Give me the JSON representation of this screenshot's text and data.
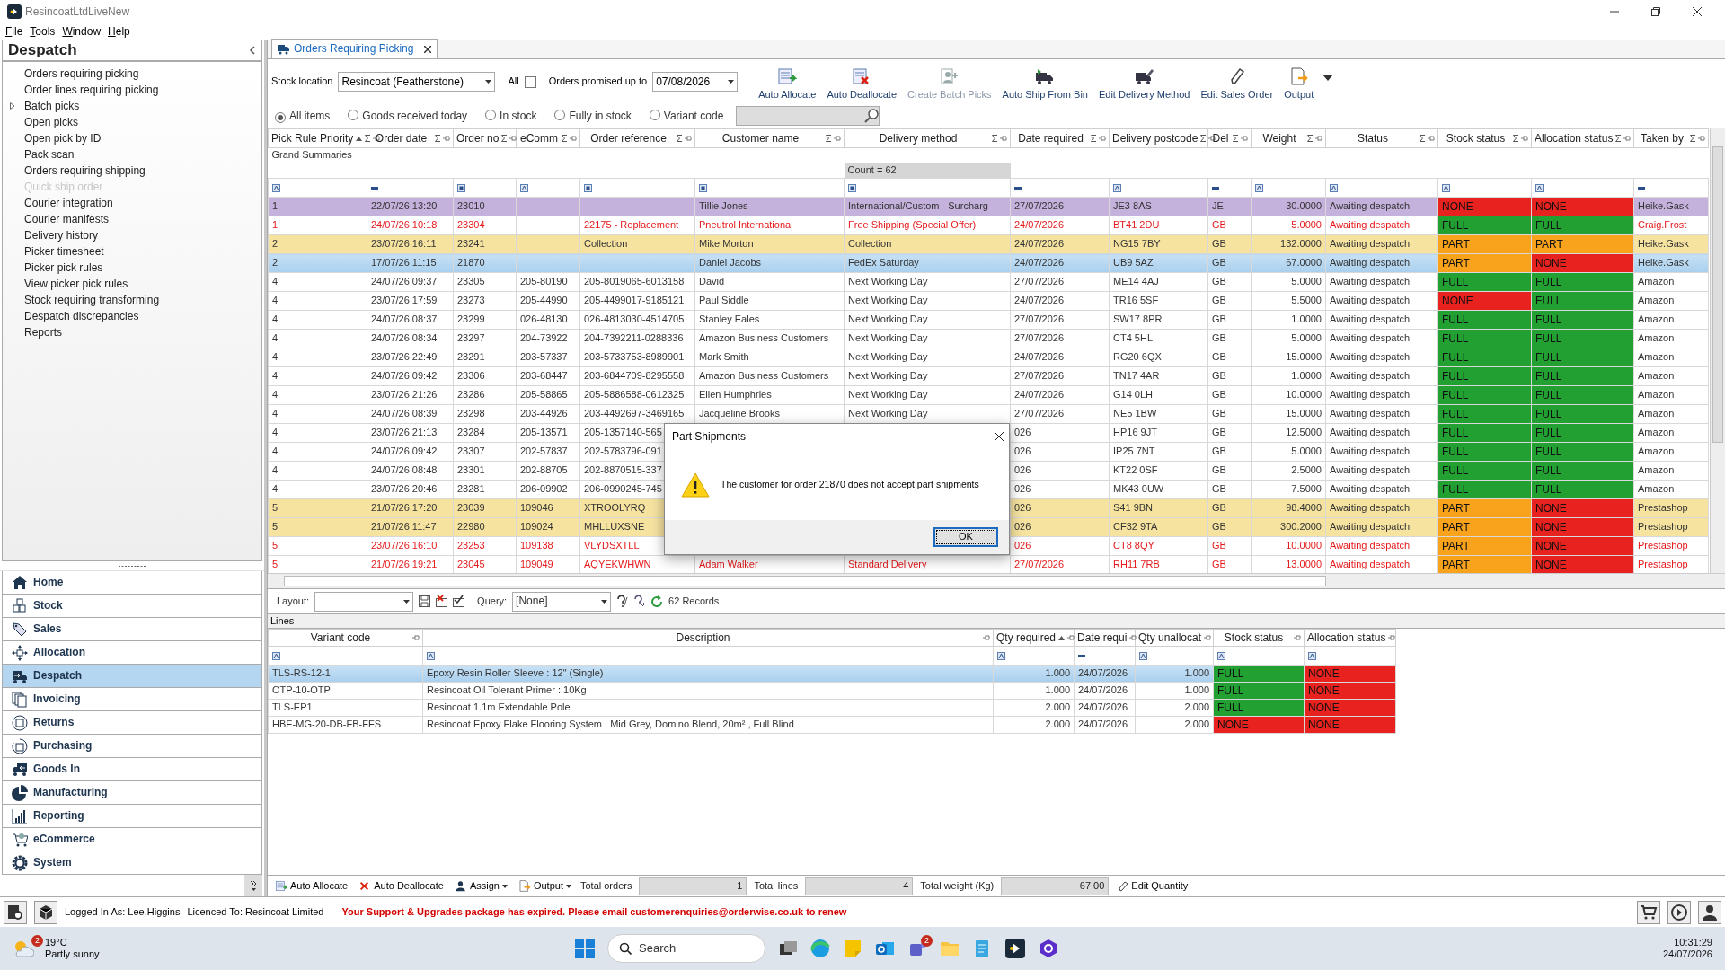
{
  "window": {
    "title": "ResincoatLtdLiveNew"
  },
  "menu": [
    "File",
    "Tools",
    "Window",
    "Help"
  ],
  "sidebar": {
    "title": "Despatch",
    "items": [
      {
        "label": "Orders requiring picking",
        "disabled": false,
        "expandable": false
      },
      {
        "label": "Order lines requiring picking",
        "disabled": false,
        "expandable": false
      },
      {
        "label": "Batch picks",
        "disabled": false,
        "expandable": true
      },
      {
        "label": "Open picks",
        "disabled": false,
        "expandable": false
      },
      {
        "label": "Open pick by ID",
        "disabled": false,
        "expandable": false
      },
      {
        "label": "Pack scan",
        "disabled": false,
        "expandable": false
      },
      {
        "label": "Orders requiring shipping",
        "disabled": false,
        "expandable": false
      },
      {
        "label": "Quick ship order",
        "disabled": true,
        "expandable": false
      },
      {
        "label": "Courier integration",
        "disabled": false,
        "expandable": false
      },
      {
        "label": "Courier manifests",
        "disabled": false,
        "expandable": false
      },
      {
        "label": "Delivery history",
        "disabled": false,
        "expandable": false
      },
      {
        "label": "Picker timesheet",
        "disabled": false,
        "expandable": false
      },
      {
        "label": "Picker pick rules",
        "disabled": false,
        "expandable": false
      },
      {
        "label": "View picker pick rules",
        "disabled": false,
        "expandable": false
      },
      {
        "label": "Stock requiring transforming",
        "disabled": false,
        "expandable": false
      },
      {
        "label": "Despatch discrepancies",
        "disabled": false,
        "expandable": false
      },
      {
        "label": "Reports",
        "disabled": false,
        "expandable": false
      }
    ],
    "modules": [
      {
        "label": "Home",
        "selected": false
      },
      {
        "label": "Stock",
        "selected": false
      },
      {
        "label": "Sales",
        "selected": false
      },
      {
        "label": "Allocation",
        "selected": false
      },
      {
        "label": "Despatch",
        "selected": true
      },
      {
        "label": "Invoicing",
        "selected": false
      },
      {
        "label": "Returns",
        "selected": false
      },
      {
        "label": "Purchasing",
        "selected": false
      },
      {
        "label": "Goods In",
        "selected": false
      },
      {
        "label": "Manufacturing",
        "selected": false
      },
      {
        "label": "Reporting",
        "selected": false
      },
      {
        "label": "eCommerce",
        "selected": false
      },
      {
        "label": "System",
        "selected": false
      }
    ]
  },
  "tab": {
    "label": "Orders Requiring Picking"
  },
  "filters": {
    "stock_location_label": "Stock location",
    "stock_location": "Resincoat (Featherstone)",
    "all_label": "All",
    "all_checked": false,
    "promised_label": "Orders promised up to",
    "promised_date": "07/08/2026"
  },
  "toolbar": [
    {
      "label": "Auto Allocate",
      "disabled": false,
      "dropdown": false
    },
    {
      "label": "Auto Deallocate",
      "disabled": false,
      "dropdown": false
    },
    {
      "label": "Create Batch Picks",
      "disabled": true,
      "dropdown": false
    },
    {
      "label": "Auto Ship From Bin",
      "disabled": false,
      "dropdown": false
    },
    {
      "label": "Edit Delivery Method",
      "disabled": false,
      "dropdown": false
    },
    {
      "label": "Edit Sales Order",
      "disabled": false,
      "dropdown": false
    },
    {
      "label": "Output",
      "disabled": false,
      "dropdown": true
    }
  ],
  "radios": [
    {
      "label": "All items",
      "selected": true
    },
    {
      "label": "Goods received today",
      "selected": false
    },
    {
      "label": "In stock",
      "selected": false
    },
    {
      "label": "Fully in stock",
      "selected": false
    },
    {
      "label": "Variant code",
      "selected": false
    }
  ],
  "grid": {
    "columns": [
      {
        "label": "Pick Rule Priority",
        "sorted": true
      },
      {
        "label": "Order date",
        "sorted": false
      },
      {
        "label": "Order no",
        "sorted": false
      },
      {
        "label": "eComm",
        "sorted": false
      },
      {
        "label": "Order reference",
        "sorted": false
      },
      {
        "label": "Customer name",
        "sorted": false
      },
      {
        "label": "Delivery method",
        "sorted": false
      },
      {
        "label": "Date required",
        "sorted": false
      },
      {
        "label": "Delivery postcode",
        "sorted": false
      },
      {
        "label": "Del",
        "sorted": false
      },
      {
        "label": "Weight",
        "sorted": false
      },
      {
        "label": "Status",
        "sorted": false
      },
      {
        "label": "Stock status",
        "sorted": false
      },
      {
        "label": "Allocation status",
        "sorted": false
      },
      {
        "label": "Taken by",
        "sorted": false
      }
    ],
    "summary_label": "Grand Summaries",
    "count": "Count = 62",
    "rows": [
      {
        "color": "#c4b1dc",
        "selected": false,
        "alert": false,
        "cells": [
          "1",
          "22/07/26 13:20",
          "23010",
          null,
          null,
          "Tillie Jones",
          "International/Custom - Surcharg",
          "27/07/2026",
          "JE3 8AS",
          "JE",
          "30.0000",
          "Awaiting despatch",
          {
            "text": "NONE",
            "color": "#e8221e"
          },
          {
            "text": "NONE",
            "color": "#e8221e"
          },
          "Heike.Gask"
        ]
      },
      {
        "color": "#ffffff",
        "selected": false,
        "alert": true,
        "cells": [
          "1",
          "24/07/26 10:18",
          "23304",
          null,
          "22175 - Replacement",
          "Pneutrol International",
          "Free Shipping (Special Offer)",
          "24/07/2026",
          "BT41 2DU",
          "GB",
          "5.0000",
          "Awaiting despatch",
          {
            "text": "FULL",
            "color": "#22a132"
          },
          {
            "text": "FULL",
            "color": "#22a132"
          },
          "Craig.Frost"
        ]
      },
      {
        "color": "#f6e3a0",
        "selected": false,
        "alert": false,
        "cells": [
          "2",
          "23/07/26 16:11",
          "23241",
          null,
          "Collection",
          "Mike Morton",
          "Collection",
          "24/07/2026",
          "NG15 7BY",
          "GB",
          "132.0000",
          "Awaiting despatch",
          {
            "text": "PART",
            "color": "#f9a21c"
          },
          {
            "text": "PART",
            "color": "#f9a21c"
          },
          "Heike.Gask"
        ]
      },
      {
        "color": "#ffffff",
        "selected": true,
        "alert": false,
        "cells": [
          "2",
          "17/07/26 11:15",
          "21870",
          null,
          null,
          "Daniel Jacobs",
          "FedEx Saturday",
          "24/07/2026",
          "UB9 5AZ",
          "GB",
          "67.0000",
          "Awaiting despatch",
          {
            "text": "PART",
            "color": "#f9a21c"
          },
          {
            "text": "NONE",
            "color": "#e8221e"
          },
          "Heike.Gask"
        ]
      },
      {
        "color": "#ffffff",
        "selected": false,
        "alert": false,
        "cells": [
          "4",
          "24/07/26 09:37",
          "23305",
          "205-80190",
          "205-8019065-6013158",
          "David",
          "Next Working Day",
          "27/07/2026",
          "ME14 4AJ",
          "GB",
          "5.0000",
          "Awaiting despatch",
          {
            "text": "FULL",
            "color": "#22a132"
          },
          {
            "text": "FULL",
            "color": "#22a132"
          },
          "Amazon"
        ]
      },
      {
        "color": "#ffffff",
        "selected": false,
        "alert": false,
        "cells": [
          "4",
          "23/07/26 17:59",
          "23273",
          "205-44990",
          "205-4499017-9185121",
          "Paul Siddle",
          "Next Working Day",
          "24/07/2026",
          "TR16 5SF",
          "GB",
          "5.5000",
          "Awaiting despatch",
          {
            "text": "NONE",
            "color": "#e8221e"
          },
          {
            "text": "FULL",
            "color": "#22a132"
          },
          "Amazon"
        ]
      },
      {
        "color": "#ffffff",
        "selected": false,
        "alert": false,
        "cells": [
          "4",
          "24/07/26 08:37",
          "23299",
          "026-48130",
          "026-4813030-4514705",
          "Stanley Eales",
          "Next Working Day",
          "27/07/2026",
          "SW17 8PR",
          "GB",
          "1.0000",
          "Awaiting despatch",
          {
            "text": "FULL",
            "color": "#22a132"
          },
          {
            "text": "FULL",
            "color": "#22a132"
          },
          "Amazon"
        ]
      },
      {
        "color": "#ffffff",
        "selected": false,
        "alert": false,
        "cells": [
          "4",
          "24/07/26 08:34",
          "23297",
          "204-73922",
          "204-7392211-0288336",
          "Amazon Business Customers",
          "Next Working Day",
          "27/07/2026",
          "CT4 5HL",
          "GB",
          "5.0000",
          "Awaiting despatch",
          {
            "text": "FULL",
            "color": "#22a132"
          },
          {
            "text": "FULL",
            "color": "#22a132"
          },
          "Amazon"
        ]
      },
      {
        "color": "#ffffff",
        "selected": false,
        "alert": false,
        "cells": [
          "4",
          "23/07/26 22:49",
          "23291",
          "203-57337",
          "203-5733753-8989901",
          "Mark Smith",
          "Next Working Day",
          "24/07/2026",
          "RG20 6QX",
          "GB",
          "15.0000",
          "Awaiting despatch",
          {
            "text": "FULL",
            "color": "#22a132"
          },
          {
            "text": "FULL",
            "color": "#22a132"
          },
          "Amazon"
        ]
      },
      {
        "color": "#ffffff",
        "selected": false,
        "alert": false,
        "cells": [
          "4",
          "24/07/26 09:42",
          "23306",
          "203-68447",
          "203-6844709-8295558",
          "Amazon Business Customers",
          "Next Working Day",
          "27/07/2026",
          "TN17 4AR",
          "GB",
          "1.0000",
          "Awaiting despatch",
          {
            "text": "FULL",
            "color": "#22a132"
          },
          {
            "text": "FULL",
            "color": "#22a132"
          },
          "Amazon"
        ]
      },
      {
        "color": "#ffffff",
        "selected": false,
        "alert": false,
        "cells": [
          "4",
          "23/07/26 21:26",
          "23286",
          "205-58865",
          "205-5886588-0612325",
          "Ellen Humphries",
          "Next Working Day",
          "24/07/2026",
          "G14 0LH",
          "GB",
          "10.0000",
          "Awaiting despatch",
          {
            "text": "FULL",
            "color": "#22a132"
          },
          {
            "text": "FULL",
            "color": "#22a132"
          },
          "Amazon"
        ]
      },
      {
        "color": "#ffffff",
        "selected": false,
        "alert": false,
        "cells": [
          "4",
          "24/07/26 08:39",
          "23298",
          "203-44926",
          "203-4492697-3469165",
          "Jacqueline Brooks",
          "Next Working Day",
          "27/07/2026",
          "NE5 1BW",
          "GB",
          "15.0000",
          "Awaiting despatch",
          {
            "text": "FULL",
            "color": "#22a132"
          },
          {
            "text": "FULL",
            "color": "#22a132"
          },
          "Amazon"
        ]
      },
      {
        "color": "#ffffff",
        "selected": false,
        "alert": false,
        "cells": [
          "4",
          "23/07/26 21:13",
          "23284",
          "205-13571",
          "205-1357140-565",
          null,
          null,
          "026",
          "HP16 9JT",
          "GB",
          "12.5000",
          "Awaiting despatch",
          {
            "text": "FULL",
            "color": "#22a132"
          },
          {
            "text": "FULL",
            "color": "#22a132"
          },
          "Amazon"
        ]
      },
      {
        "color": "#ffffff",
        "selected": false,
        "alert": false,
        "cells": [
          "4",
          "24/07/26 09:42",
          "23307",
          "202-57837",
          "202-5783796-091",
          null,
          null,
          "026",
          "IP25 7NT",
          "GB",
          "5.0000",
          "Awaiting despatch",
          {
            "text": "FULL",
            "color": "#22a132"
          },
          {
            "text": "FULL",
            "color": "#22a132"
          },
          "Amazon"
        ]
      },
      {
        "color": "#ffffff",
        "selected": false,
        "alert": false,
        "cells": [
          "4",
          "24/07/26 08:48",
          "23301",
          "202-88705",
          "202-8870515-337",
          null,
          null,
          "026",
          "KT22 0SF",
          "GB",
          "2.5000",
          "Awaiting despatch",
          {
            "text": "FULL",
            "color": "#22a132"
          },
          {
            "text": "FULL",
            "color": "#22a132"
          },
          "Amazon"
        ]
      },
      {
        "color": "#ffffff",
        "selected": false,
        "alert": false,
        "cells": [
          "4",
          "23/07/26 20:46",
          "23281",
          "206-09902",
          "206-0990245-745",
          null,
          null,
          "026",
          "MK43 0UW",
          "GB",
          "7.5000",
          "Awaiting despatch",
          {
            "text": "FULL",
            "color": "#22a132"
          },
          {
            "text": "FULL",
            "color": "#22a132"
          },
          "Amazon"
        ]
      },
      {
        "color": "#f6e3a0",
        "selected": false,
        "alert": false,
        "cells": [
          "5",
          "21/07/26 17:20",
          "23039",
          "109046",
          "XTROOLYRQ",
          null,
          null,
          "026",
          "S41 9BN",
          "GB",
          "98.4000",
          "Awaiting despatch",
          {
            "text": "PART",
            "color": "#f9a21c"
          },
          {
            "text": "NONE",
            "color": "#e8221e"
          },
          "Prestashop"
        ]
      },
      {
        "color": "#f6e3a0",
        "selected": false,
        "alert": false,
        "cells": [
          "5",
          "21/07/26 11:47",
          "22980",
          "109024",
          "MHLLUXSNE",
          null,
          null,
          "026",
          "CF32 9TA",
          "GB",
          "300.2000",
          "Awaiting despatch",
          {
            "text": "PART",
            "color": "#f9a21c"
          },
          {
            "text": "NONE",
            "color": "#e8221e"
          },
          "Prestashop"
        ]
      },
      {
        "color": "#ffffff",
        "selected": false,
        "alert": true,
        "cells": [
          "5",
          "23/07/26 16:10",
          "23253",
          "109138",
          "VLYDSXTLL",
          null,
          null,
          "026",
          "CT8 8QY",
          "GB",
          "10.0000",
          "Awaiting despatch",
          {
            "text": "PART",
            "color": "#f9a21c"
          },
          {
            "text": "NONE",
            "color": "#e8221e"
          },
          "Prestashop"
        ]
      },
      {
        "color": "#ffffff",
        "selected": false,
        "alert": true,
        "cells": [
          "5",
          "21/07/26 19:21",
          "23045",
          "109049",
          "AQYEKWHWN",
          "Adam Walker",
          "Standard Delivery",
          "27/07/2026",
          "RH11 7RB",
          "GB",
          "13.0000",
          "Awaiting despatch",
          {
            "text": "PART",
            "color": "#f9a21c"
          },
          {
            "text": "NONE",
            "color": "#e8221e"
          },
          "Prestashop"
        ]
      }
    ]
  },
  "dialog": {
    "title": "Part Shipments",
    "message": "The customer for order 21870 does not accept part shipments",
    "button": "OK"
  },
  "grid_footer": {
    "layout_label": "Layout:",
    "query_label": "Query:",
    "query": "[None]",
    "records": "62 Records"
  },
  "lines": {
    "title": "Lines",
    "columns": [
      {
        "label": "Variant code",
        "sorted": false
      },
      {
        "label": "Description",
        "sorted": false
      },
      {
        "label": "Qty required",
        "sorted": true
      },
      {
        "label": "Date requi",
        "sorted": false
      },
      {
        "label": "Qty unallocat",
        "sorted": false
      },
      {
        "label": "Stock status",
        "sorted": false
      },
      {
        "label": "Allocation status",
        "sorted": false
      }
    ],
    "rows": [
      {
        "selected": true,
        "cells": [
          "TLS-RS-12-1",
          "Epoxy Resin Roller Sleeve : 12\" (Single)",
          "1.000",
          "24/07/2026",
          "1.000",
          {
            "text": "FULL",
            "color": "#22a132"
          },
          {
            "text": "NONE",
            "color": "#e8221e"
          }
        ]
      },
      {
        "selected": false,
        "cells": [
          "OTP-10-OTP",
          "Resincoat Oil Tolerant Primer : 10Kg",
          "1.000",
          "24/07/2026",
          "1.000",
          {
            "text": "FULL",
            "color": "#22a132"
          },
          {
            "text": "NONE",
            "color": "#e8221e"
          }
        ]
      },
      {
        "selected": false,
        "cells": [
          "TLS-EP1",
          "Resincoat 1.1m Extendable Pole",
          "2.000",
          "24/07/2026",
          "2.000",
          {
            "text": "FULL",
            "color": "#22a132"
          },
          {
            "text": "NONE",
            "color": "#e8221e"
          }
        ]
      },
      {
        "selected": false,
        "cells": [
          "HBE-MG-20-DB-FB-FFS",
          "Resincoat Epoxy Flake Flooring System : Mid Grey, Domino Blend, 20m² , Full Blind",
          "2.000",
          "24/07/2026",
          "2.000",
          {
            "text": "NONE",
            "color": "#e8221e"
          },
          {
            "text": "NONE",
            "color": "#e8221e"
          }
        ]
      }
    ]
  },
  "actions": [
    {
      "label": "Auto Allocate",
      "dropdown": false
    },
    {
      "label": "Auto Deallocate",
      "dropdown": false
    },
    {
      "label": "Assign",
      "dropdown": true
    },
    {
      "label": "Output",
      "dropdown": true
    }
  ],
  "totals": [
    {
      "label": "Total orders",
      "value": "1"
    },
    {
      "label": "Total lines",
      "value": "4"
    },
    {
      "label": "Total weight (Kg)",
      "value": "67.00"
    }
  ],
  "edit_quantity": "Edit Quantity",
  "status_bar": {
    "logged_in": "Logged In As: Lee.Higgins",
    "licence": "Licenced To: Resincoat Limited",
    "warning": "Your Support & Upgrades package has expired. Please email customerenquiries@orderwise.co.uk to renew"
  },
  "taskbar": {
    "temperature": "19°C",
    "weather": "Partly sunny",
    "weather_badge": "2",
    "search_placeholder": "Search",
    "teams_badge": "2",
    "time": "10:31:29",
    "date": "24/07/2026"
  }
}
